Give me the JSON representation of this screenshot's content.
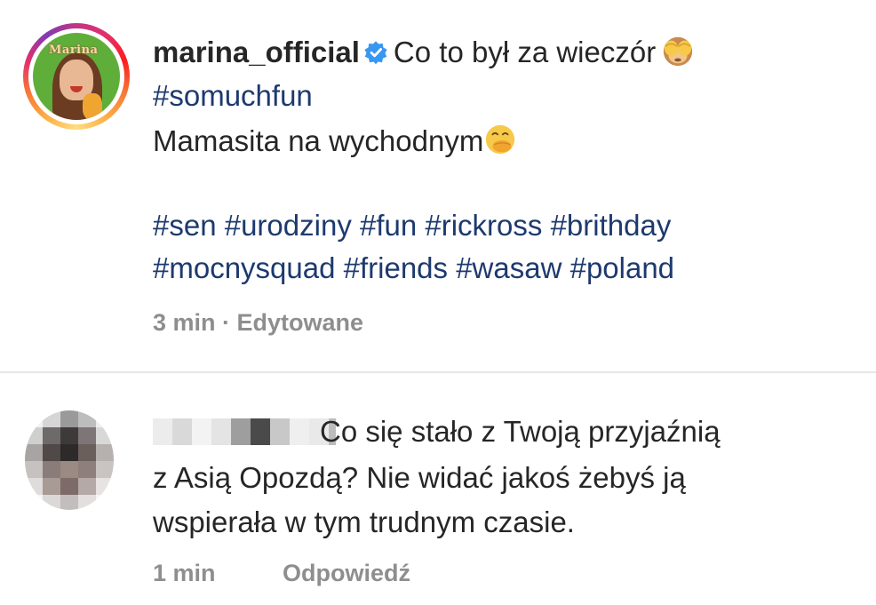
{
  "post": {
    "username": "marina_official",
    "verified_icon": "verified-badge-icon",
    "caption_line1": "Co to był za wieczór",
    "caption_line1_emoji": "see-no-evil-monkey-icon",
    "hashtag_line": "#somuchfun",
    "caption_line3": "Mamasita na wychodnym",
    "caption_line3_emoji": "face-with-hand-over-mouth-icon",
    "hashtags_line1": "#sen #urodziny #fun #rickross #brithday",
    "hashtags_line2": "#mocnysquad #friends #wasaw #poland",
    "meta": "3 min · Edytowane",
    "avatar_logo_text": "Marina"
  },
  "comment": {
    "username_blurred": true,
    "line1": "Co się stało z Twoją przyjaźnią",
    "line2": "z Asią Opozdą? Nie widać jakoś żebyś ją",
    "line3": "wspierała w tym trudnym czasie.",
    "time": "1 min",
    "reply_label": "Odpowiedź"
  },
  "colors": {
    "text": "#262626",
    "hashtag": "#1d3a6e",
    "meta": "#8e8e8e",
    "verified": "#3897f0",
    "divider": "#e6e6e6"
  }
}
